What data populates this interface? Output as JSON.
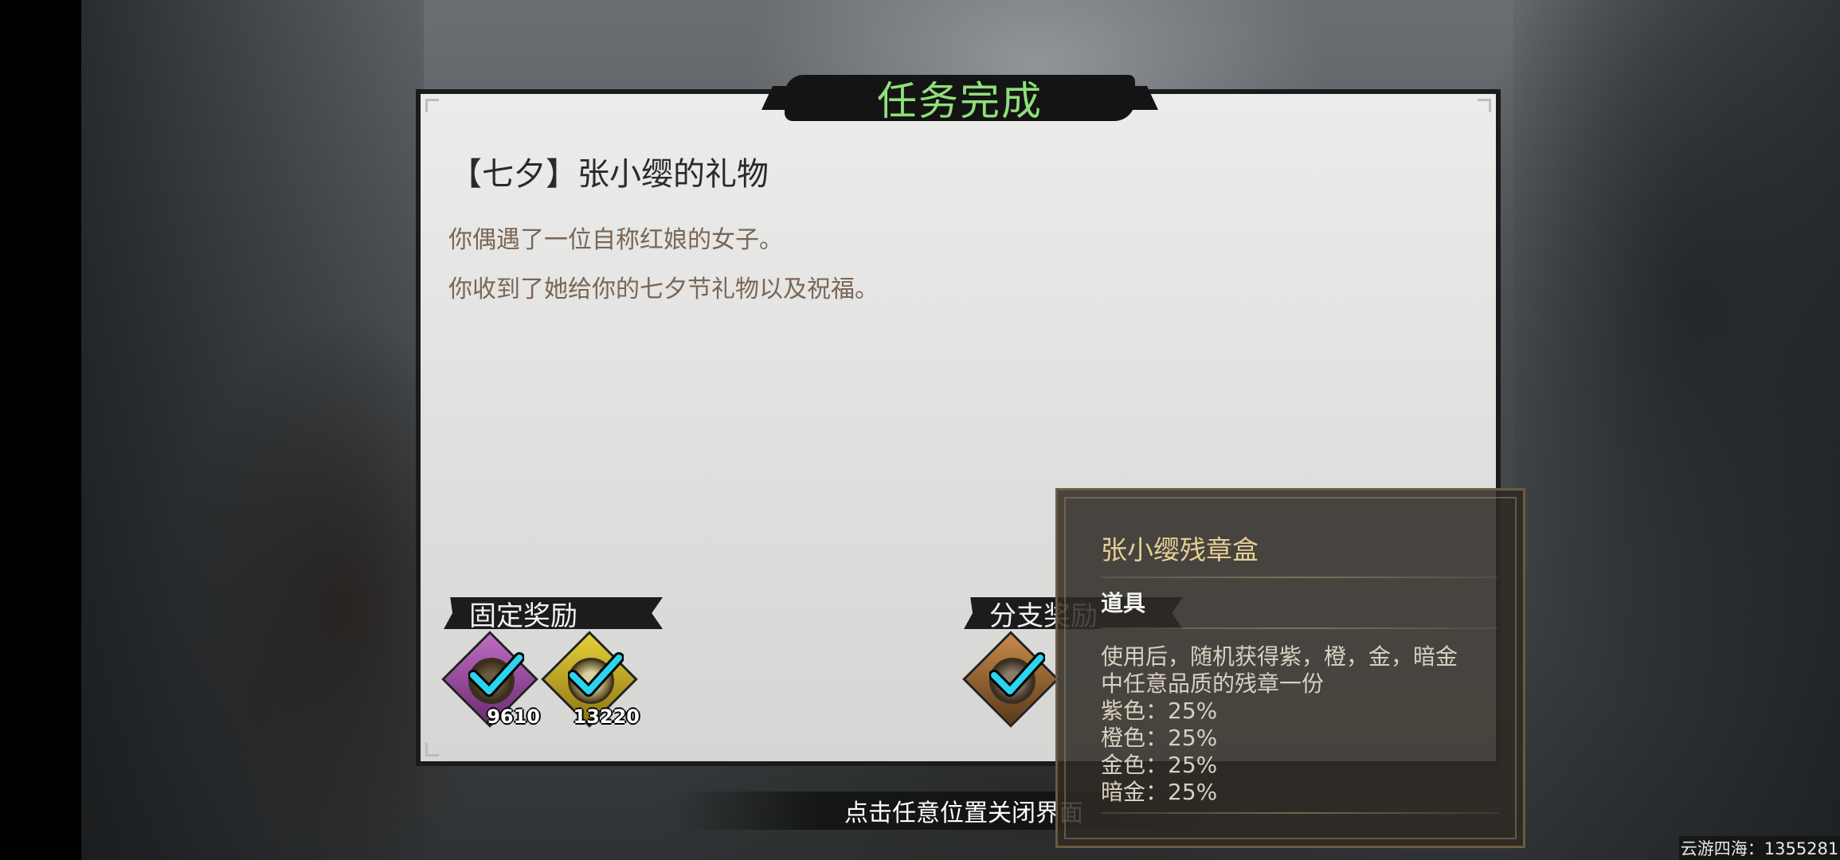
{
  "dialog": {
    "title": "任务完成",
    "quest_name": "【七夕】张小缨的礼物",
    "description": [
      "你偶遇了一位自称红娘的女子。",
      "你收到了她给你的七夕节礼物以及祝福。"
    ]
  },
  "fixed_rewards": {
    "label": "固定奖励",
    "items": [
      {
        "icon": "coin-icon",
        "color": "#8b3f8f",
        "count": "9610"
      },
      {
        "icon": "coin-icon",
        "color": "#b79a1a",
        "count": "13220"
      }
    ]
  },
  "branch_rewards": {
    "label": "分支奖励",
    "items": [
      {
        "icon": "badge-box-icon",
        "color": "#9a6a3a"
      }
    ]
  },
  "close_hint": "点击任意位置关闭界面",
  "tooltip": {
    "name": "张小缨残章盒",
    "type": "道具",
    "lines": [
      "使用后，随机获得紫，橙，金，暗金",
      "中任意品质的残章一份",
      "紫色：25%",
      "橙色：25%",
      "金色：25%",
      "暗金：25%"
    ]
  },
  "watermark": "云游四海：1355281",
  "colors": {
    "title_green": "#8fe07a",
    "check_cyan": "#2bd5f0",
    "tooltip_name": "#e6cf94"
  }
}
